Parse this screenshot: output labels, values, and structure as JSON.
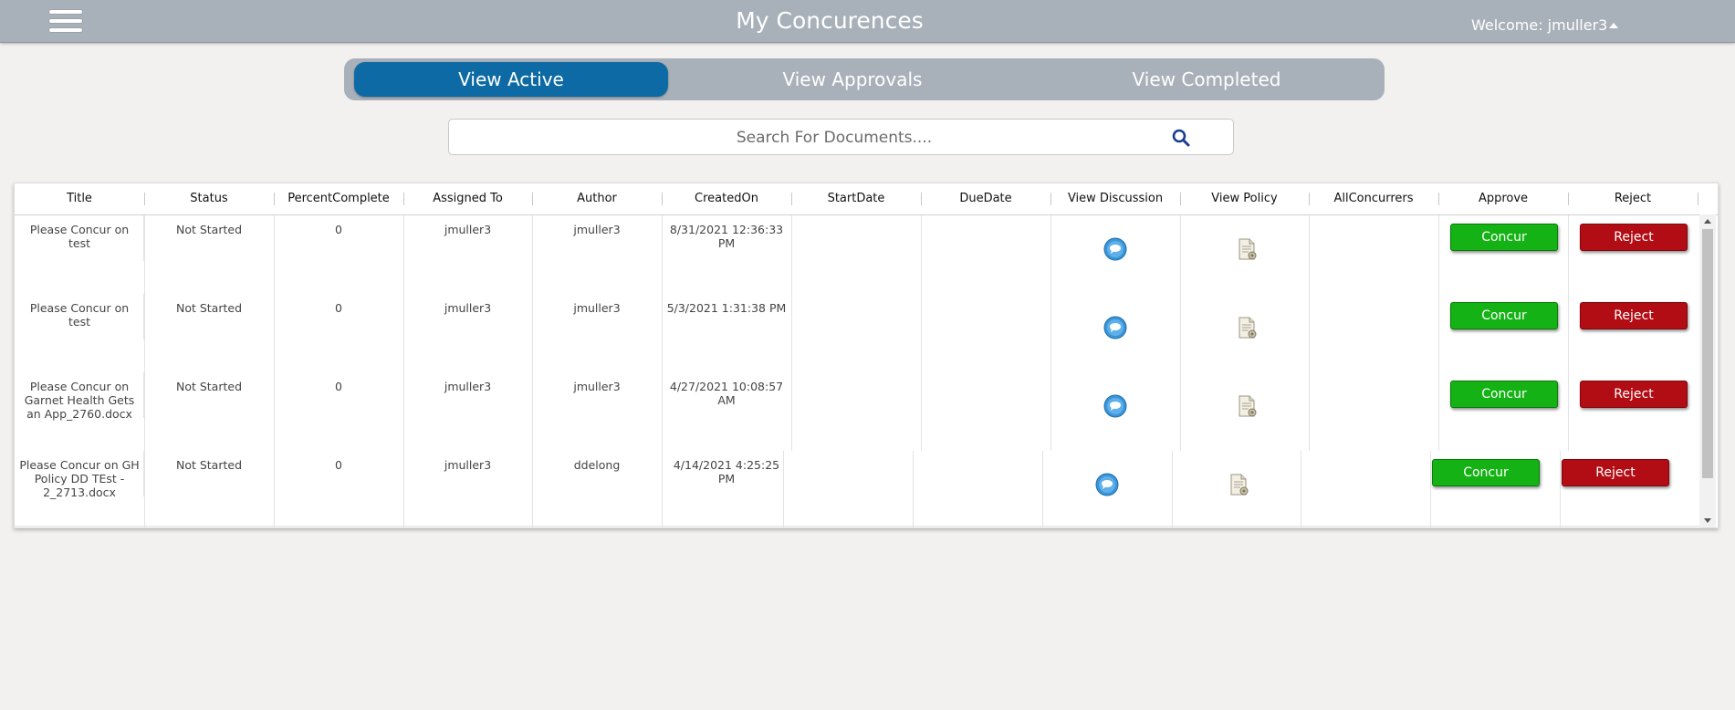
{
  "header": {
    "title": "My Concurences",
    "welcome": "Welcome: jmuller3"
  },
  "tabs": [
    {
      "label": "View Active",
      "active": true
    },
    {
      "label": "View Approvals",
      "active": false
    },
    {
      "label": "View Completed",
      "active": false
    }
  ],
  "search": {
    "placeholder": "Search For Documents...."
  },
  "columns": [
    "Title",
    "Status",
    "PercentComplete",
    "Assigned To",
    "Author",
    "CreatedOn",
    "StartDate",
    "DueDate",
    "View Discussion",
    "View Policy",
    "AllConcurrers",
    "Approve",
    "Reject"
  ],
  "rows": [
    {
      "title": "Please Concur on test",
      "status": "Not Started",
      "percent": "0",
      "assigned": "jmuller3",
      "author": "jmuller3",
      "created": "8/31/2021 12:36:33 PM",
      "start": "",
      "due": "",
      "concurrers": "",
      "approve": "Concur",
      "reject": "Reject"
    },
    {
      "title": "Please Concur on test",
      "status": "Not Started",
      "percent": "0",
      "assigned": "jmuller3",
      "author": "jmuller3",
      "created": "5/3/2021 1:31:38 PM",
      "start": "",
      "due": "",
      "concurrers": "",
      "approve": "Concur",
      "reject": "Reject"
    },
    {
      "title": "Please Concur on Garnet Health Gets an App_2760.docx",
      "status": "Not Started",
      "percent": "0",
      "assigned": "jmuller3",
      "author": "jmuller3",
      "created": "4/27/2021 10:08:57 AM",
      "start": "",
      "due": "",
      "concurrers": "",
      "approve": "Concur",
      "reject": "Reject"
    },
    {
      "title": "Please Concur on GH Policy DD TEst - 2_2713.docx",
      "status": "Not Started",
      "percent": "0",
      "assigned": "jmuller3",
      "author": "ddelong",
      "created": "4/14/2021 4:25:25 PM",
      "start": "",
      "due": "",
      "concurrers": "",
      "approve": "Concur",
      "reject": "Reject"
    }
  ],
  "icons": {
    "menu": "hamburger-menu-icon",
    "search": "search-icon",
    "discussion": "chat-bubble-icon",
    "policy": "document-icon"
  },
  "colors": {
    "header_bg": "#a8b1b9",
    "active_tab": "#0e6aa4",
    "concur": "#14b214",
    "reject": "#b20d14"
  }
}
